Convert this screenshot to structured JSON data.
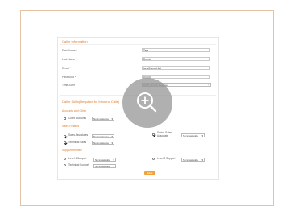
{
  "caller_information": {
    "heading": "Caller Information",
    "fields": [
      {
        "label": "First Name *",
        "value": "Tara"
      },
      {
        "label": "Last Name *",
        "value": "Dravie"
      },
      {
        "label": "Email *",
        "value": "tara@aewel.llst"
      },
      {
        "label": "Password *",
        "value": "•••••••••"
      },
      {
        "label": "Time Zone",
        "value": "(GMT+03:00) Moscow"
      }
    ]
  },
  "skills": {
    "heading": "Caller Skills(Required for Inbound Calls)",
    "groups": [
      {
        "title": "Accounts and Other",
        "items": [
          {
            "label": "Client Accounts",
            "value": "No knowledge",
            "checked": false
          }
        ]
      },
      {
        "title": "Sales Related",
        "items": [
          {
            "label": "Sales Associates",
            "value": "No knowledge",
            "checked": true
          },
          {
            "label": "Senior Sales Associate",
            "value": "No knowledge",
            "checked": true
          },
          {
            "label": "Technical Sales",
            "value": "No knowledge",
            "checked": true
          }
        ]
      },
      {
        "title": "Support Related",
        "items": [
          {
            "label": "Level 1 Support",
            "value": "No knowledge",
            "checked": false
          },
          {
            "label": "Level 2 Support",
            "value": "No knowledge",
            "checked": false
          },
          {
            "label": "Technical Support",
            "value": "No knowledge",
            "checked": false
          }
        ]
      }
    ]
  },
  "submit_label": "Save",
  "colors": {
    "accent": "#e07b2a",
    "button": "#f2a23a",
    "frame": "#e2c3a6"
  },
  "overlay_icon": "zoom-in-icon"
}
